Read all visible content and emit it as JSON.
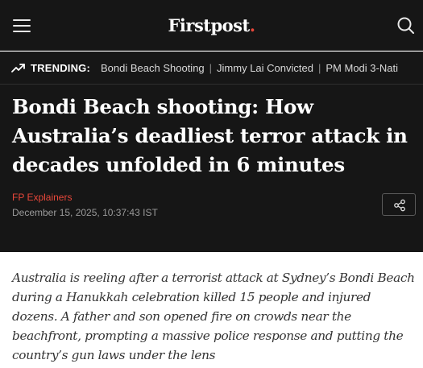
{
  "header": {
    "logo_text": "Firstpost",
    "logo_dot": ".",
    "menu_icon": "hamburger-menu-icon",
    "search_icon": "search-icon"
  },
  "trending": {
    "icon": "trending-up-icon",
    "label": "TRENDING:",
    "items": [
      "Bondi Beach Shooting",
      "Jimmy Lai Convicted",
      "PM Modi 3-Nati"
    ],
    "separator": "|"
  },
  "article": {
    "headline": "Bondi Beach shooting: How Australia’s deadliest terror attack in decades unfolded in 6 minutes",
    "category": "FP Explainers",
    "date": "December 15, 2025, 10:37:43 IST",
    "share_icon": "share-icon",
    "summary": "Australia is reeling after a terrorist attack at Sydney’s Bondi Beach during a Hanukkah celebration killed 15 people and injured dozens. A father and son opened fire on crowds near the beachfront, prompting a massive police response and putting the country’s gun laws under the lens"
  },
  "colors": {
    "background_dark": "#161616",
    "accent_red": "#e8473a",
    "text_light": "#ffffff",
    "text_muted": "#9a9a9a"
  }
}
